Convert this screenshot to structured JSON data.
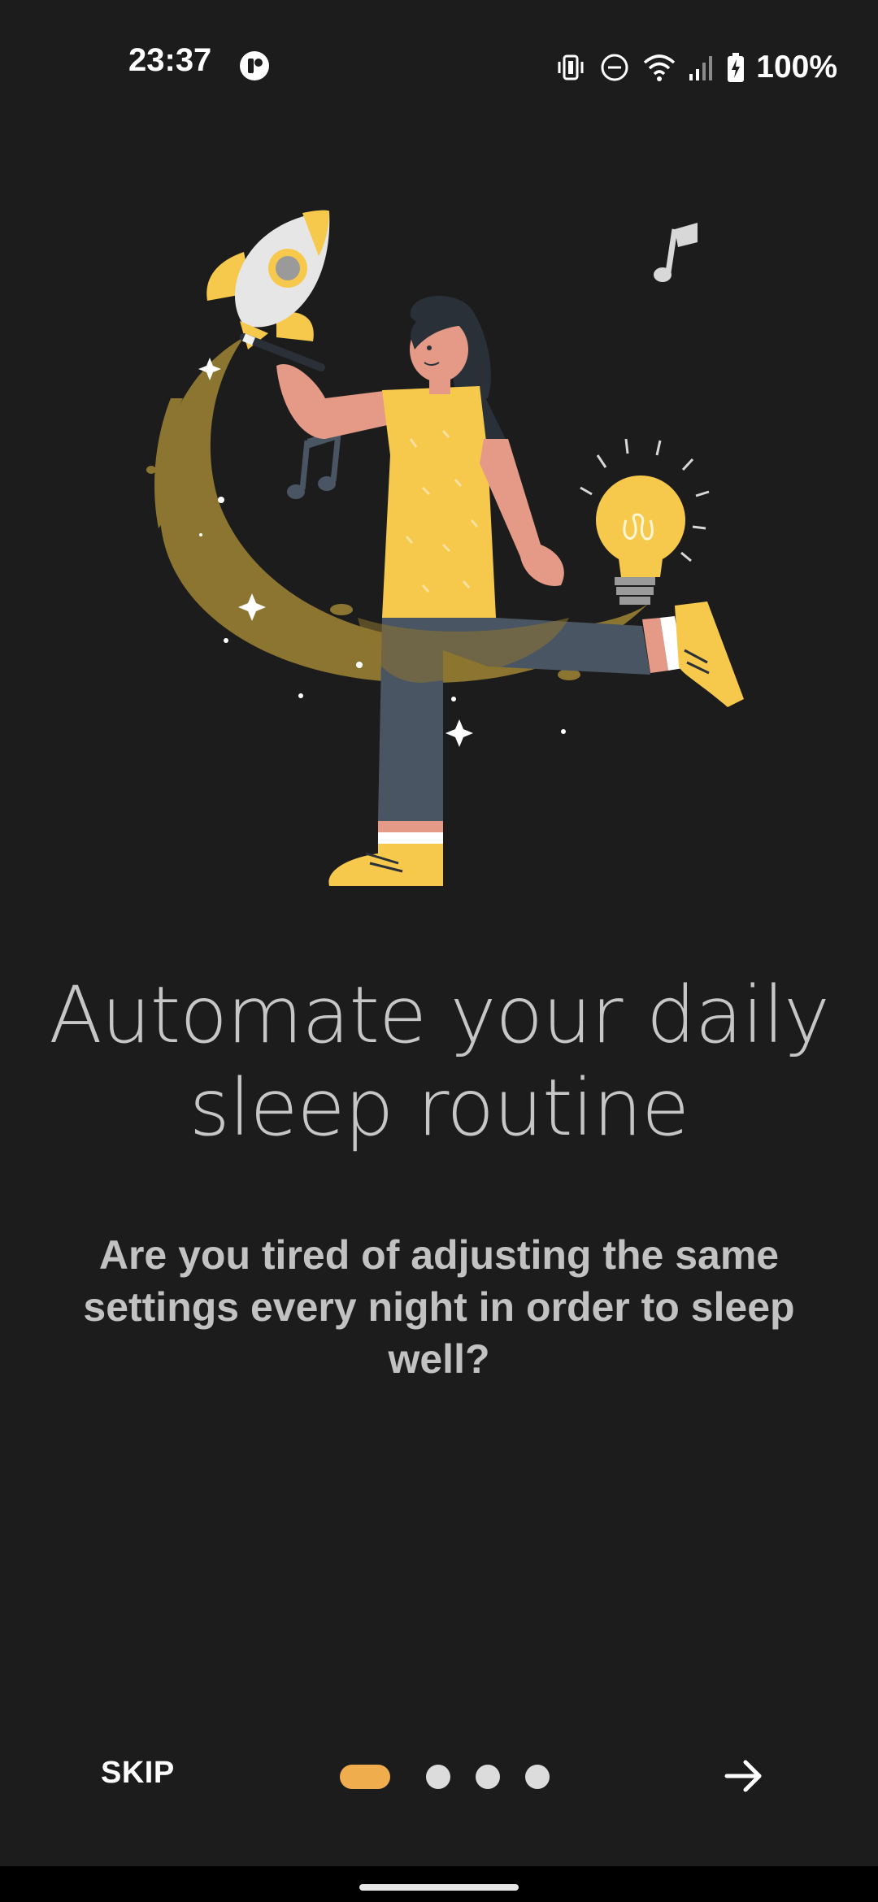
{
  "status_bar": {
    "time": "23:37",
    "battery": "100%",
    "icons": [
      "app-notification-icon",
      "vibrate-icon",
      "do-not-disturb-icon",
      "wifi-icon",
      "signal-icon",
      "battery-charging-icon"
    ]
  },
  "onboarding": {
    "title_line1": "Automate your daily",
    "title_line2": "sleep routine",
    "subtitle": "Are you tired of adjusting the same settings every night in order to sleep well?",
    "current_page": 1,
    "total_pages": 4
  },
  "footer": {
    "skip_label": "SKIP",
    "next_icon": "arrow-right-icon"
  },
  "colors": {
    "background": "#1c1c1c",
    "accent": "#f0ad4e",
    "illustration_yellow": "#f6c94c",
    "trail": "#8c7530"
  }
}
